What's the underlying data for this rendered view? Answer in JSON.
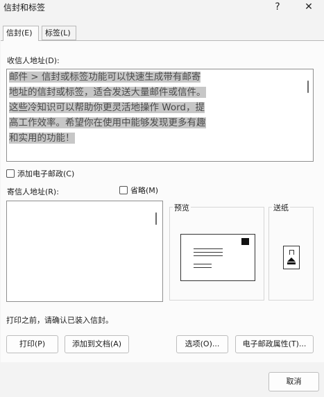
{
  "window": {
    "title": "信封和标签",
    "help_label": "?",
    "close_label": "✕"
  },
  "tabs": [
    {
      "label": "信封(E)",
      "active": true
    },
    {
      "label": "标签(L)",
      "active": false
    }
  ],
  "envelope": {
    "delivery_label": "收信人地址(D):",
    "delivery_lines": [
      "邮件 > 信封或标签功能可以快速生成带有邮寄",
      "地址的信封或标签，适合发送大量邮件或信件。",
      "这些冷知识可以帮助你更灵活地操作 Word，提",
      "高工作效率。希望你在使用中能够发现更多有趣",
      "和实用的功能！"
    ],
    "add_postage_label": "添加电子邮政(C)",
    "return_label": "寄信人地址(R):",
    "omit_label": "省略(M)",
    "return_value": "",
    "preview_label": "预览",
    "feed_label": "送纸",
    "note": "打印之前，请确认已装入信封。"
  },
  "buttons": {
    "print": "打印(P)",
    "add_to_document": "添加到文档(A)",
    "options": "选项(O)...",
    "postage_properties": "电子邮政属性(T)...",
    "cancel": "取消"
  },
  "colors": {
    "selection_highlight": "#c7c7c7",
    "panel_bg": "#fbfbfb",
    "window_bg": "#f3f3f3"
  }
}
